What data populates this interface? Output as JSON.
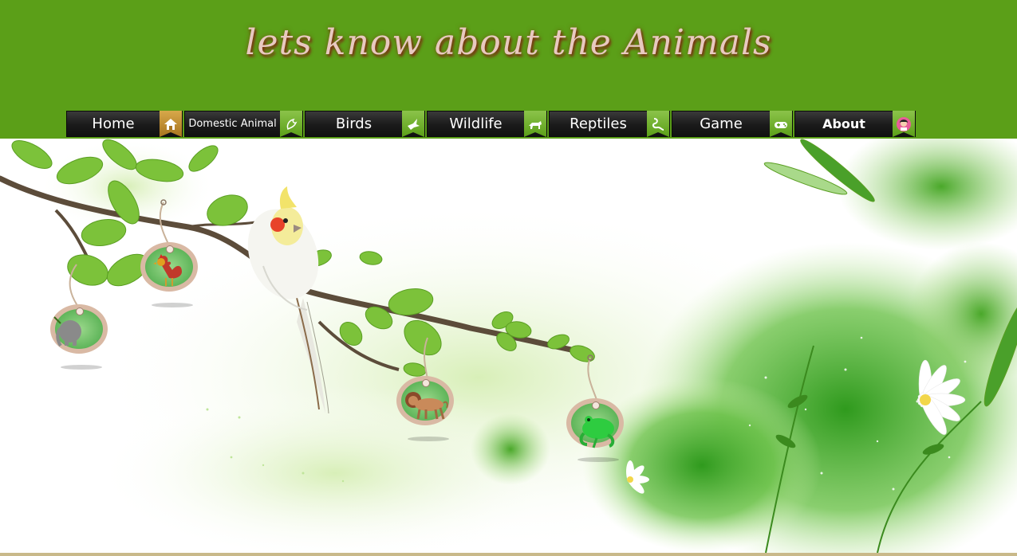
{
  "header": {
    "title": "lets know about the Animals",
    "background": "#5b9f18"
  },
  "nav": {
    "items": [
      {
        "label": "Home",
        "icon": "home-icon"
      },
      {
        "label": "Domestic Animal",
        "icon": "bird-icon"
      },
      {
        "label": "Birds",
        "icon": "dove-icon"
      },
      {
        "label": "Wildlife",
        "icon": "lion-icon"
      },
      {
        "label": "Reptiles",
        "icon": "snake-icon"
      },
      {
        "label": "Game",
        "icon": "gamepad-icon"
      },
      {
        "label": "About",
        "icon": "person-icon"
      }
    ]
  },
  "scene": {
    "tags": [
      {
        "animal": "elephant-icon"
      },
      {
        "animal": "rooster-icon"
      },
      {
        "animal": "lion-icon"
      },
      {
        "animal": "frog-icon"
      }
    ],
    "bird": "cockatiel-illustration"
  }
}
